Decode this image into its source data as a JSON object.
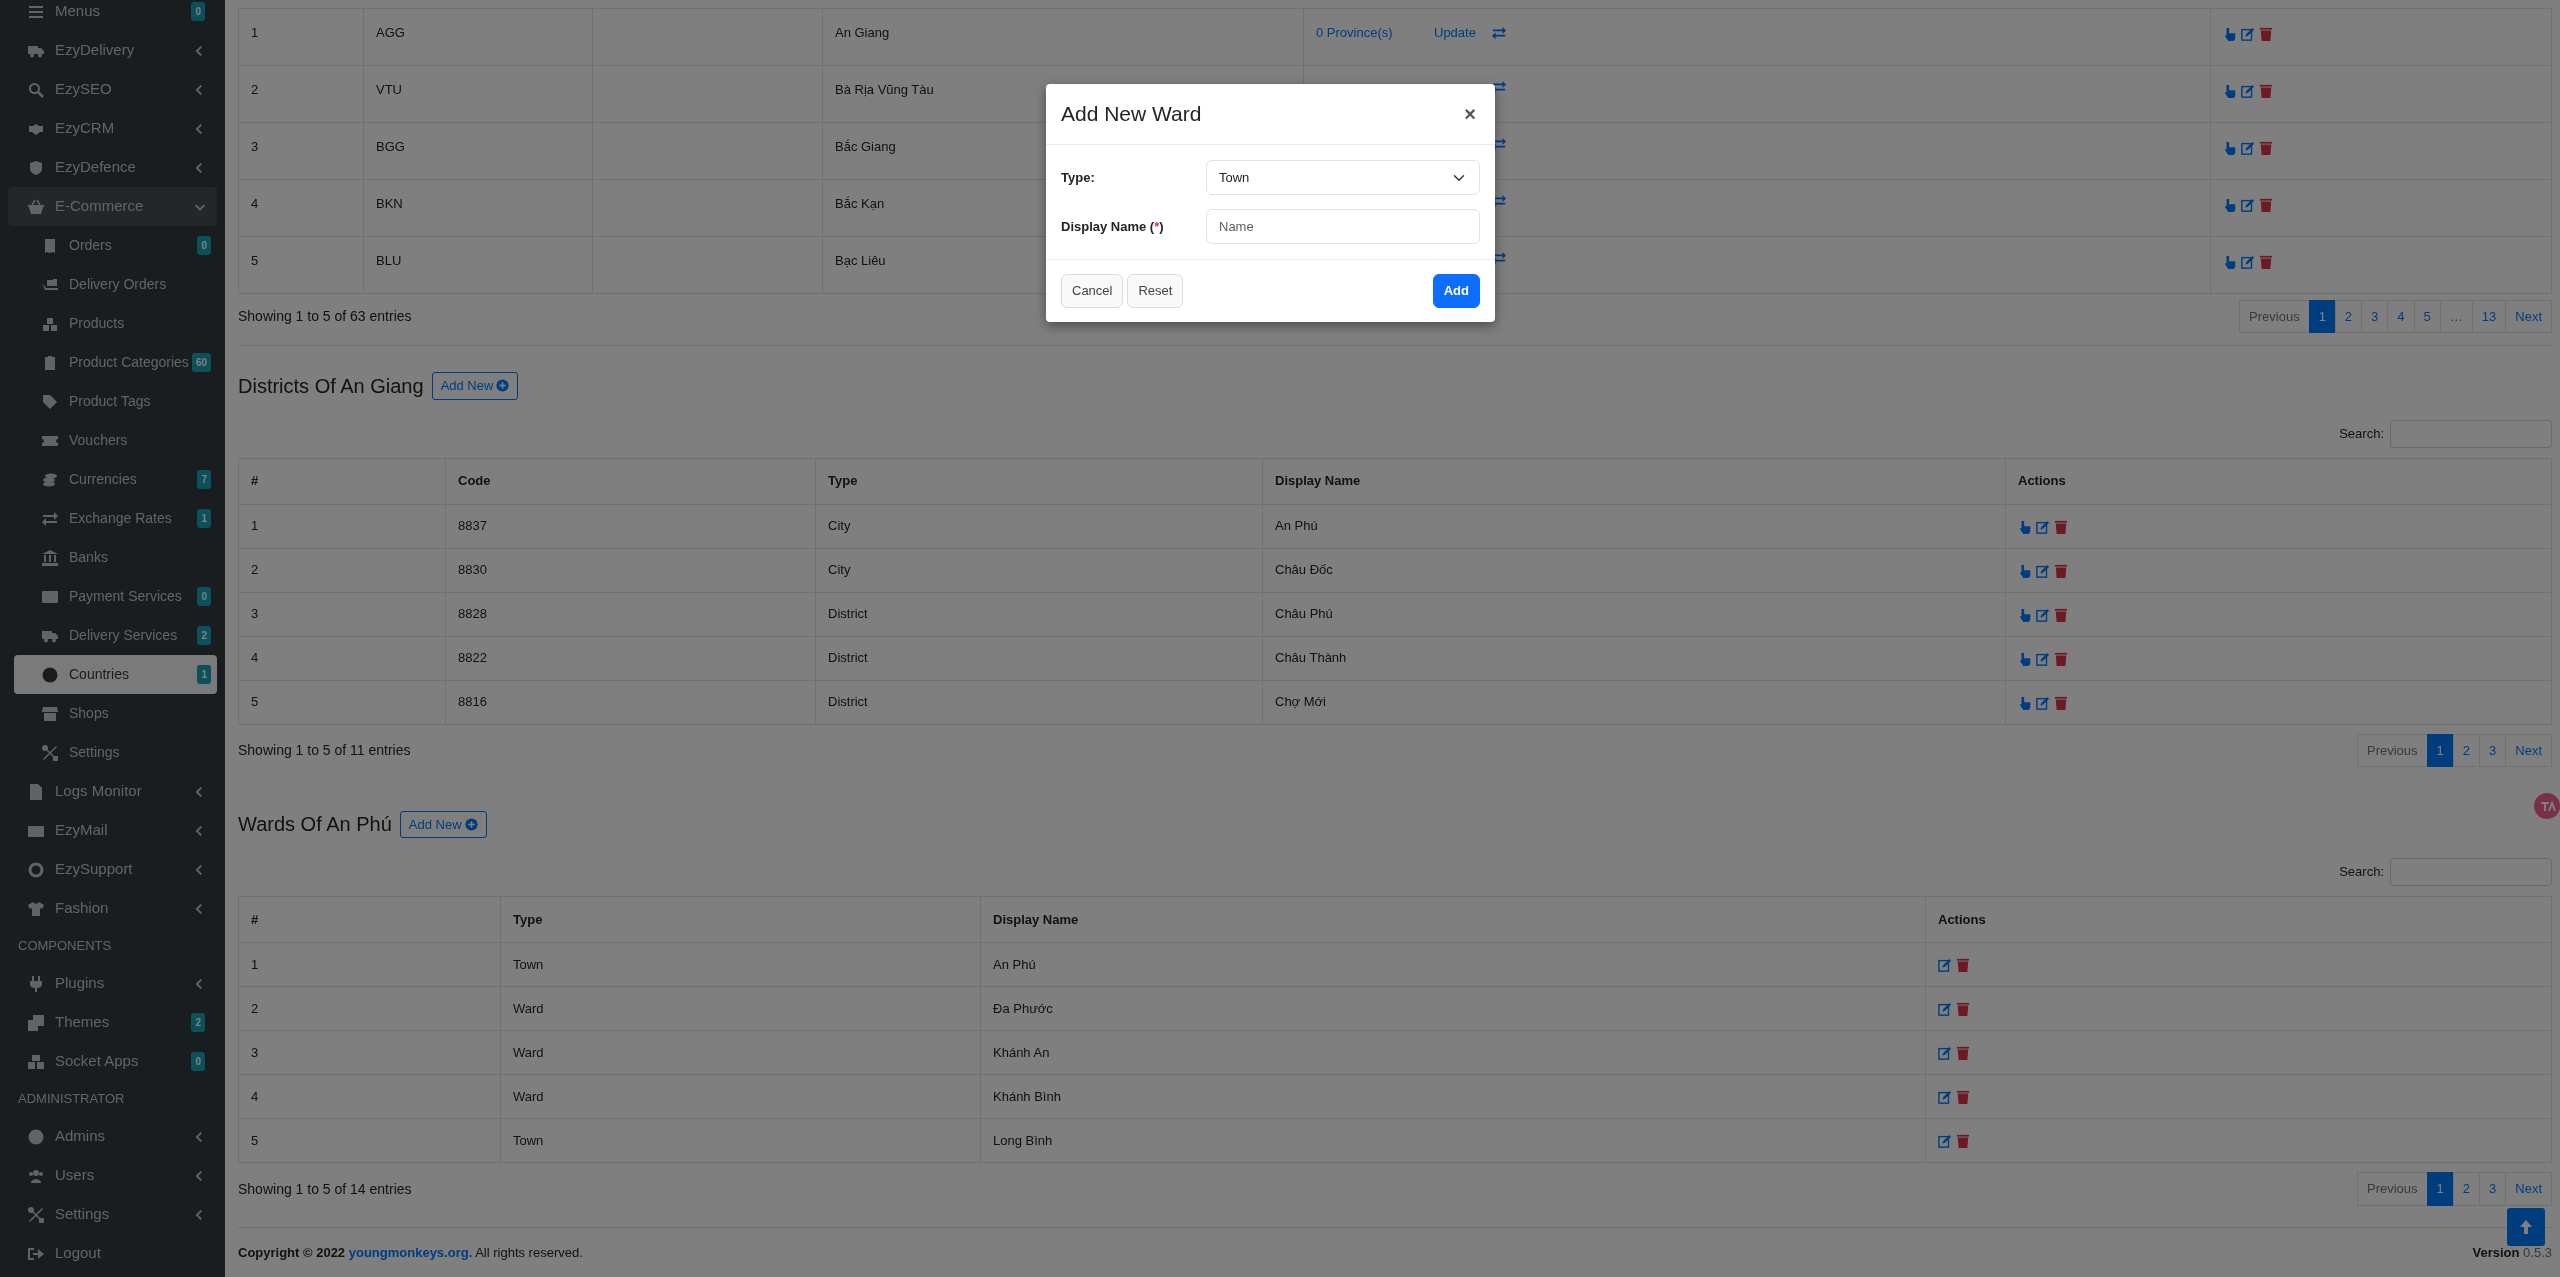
{
  "sidebar": {
    "items": [
      {
        "kind": "link",
        "label": "Menus",
        "badge": "0",
        "selected": false
      },
      {
        "kind": "link",
        "label": "EzyDelivery",
        "expanded": false,
        "selected": false
      },
      {
        "kind": "link",
        "label": "EzySEO",
        "expanded": false,
        "selected": false
      },
      {
        "kind": "link",
        "label": "EzyCRM",
        "expanded": false,
        "selected": false
      },
      {
        "kind": "link",
        "label": "EzyDefence",
        "expanded": false,
        "selected": false
      },
      {
        "kind": "link",
        "label": "E-Commerce",
        "expanded": true,
        "selected": false,
        "children": [
          {
            "label": "Orders",
            "badge": "0",
            "selected": false
          },
          {
            "label": "Delivery Orders",
            "selected": false
          },
          {
            "label": "Products",
            "selected": false
          },
          {
            "label": "Product Categories",
            "badge": "60",
            "selected": false
          },
          {
            "label": "Product Tags",
            "selected": false
          },
          {
            "label": "Vouchers",
            "selected": false
          },
          {
            "label": "Currencies",
            "badge": "7",
            "selected": false
          },
          {
            "label": "Exchange Rates",
            "badge": "1",
            "selected": false
          },
          {
            "label": "Banks",
            "selected": false
          },
          {
            "label": "Payment Services",
            "badge": "0",
            "selected": false
          },
          {
            "label": "Delivery Services",
            "badge": "2",
            "selected": false
          },
          {
            "label": "Countries",
            "badge": "1",
            "selected": true
          },
          {
            "label": "Shops",
            "selected": false
          },
          {
            "label": "Settings",
            "selected": false
          }
        ]
      },
      {
        "kind": "link",
        "label": "Logs Monitor",
        "expanded": false,
        "selected": false
      },
      {
        "kind": "link",
        "label": "EzyMail",
        "expanded": false,
        "selected": false
      },
      {
        "kind": "link",
        "label": "EzySupport",
        "expanded": false,
        "selected": false
      },
      {
        "kind": "link",
        "label": "Fashion",
        "expanded": false,
        "selected": false
      },
      {
        "kind": "header",
        "label": "COMPONENTS"
      },
      {
        "kind": "link",
        "label": "Plugins",
        "expanded": false,
        "selected": false
      },
      {
        "kind": "link",
        "label": "Themes",
        "badge": "2",
        "selected": false
      },
      {
        "kind": "link",
        "label": "Socket Apps",
        "badge": "0",
        "selected": false
      },
      {
        "kind": "header",
        "label": "ADMINISTRATOR"
      },
      {
        "kind": "link",
        "label": "Admins",
        "expanded": false,
        "selected": false
      },
      {
        "kind": "link",
        "label": "Users",
        "expanded": false,
        "selected": false
      },
      {
        "kind": "link",
        "label": "Settings",
        "expanded": false,
        "selected": false
      },
      {
        "kind": "link",
        "label": "Logout",
        "selected": false
      }
    ]
  },
  "provinces_table": {
    "rows": [
      {
        "cells": [
          "1",
          "AGG",
          "",
          "An Giang"
        ],
        "provinces_link": "0 Province(s)",
        "update_link": "Update"
      },
      {
        "cells": [
          "2",
          "VTU",
          "",
          "Bà Rịa Vũng Tàu"
        ]
      },
      {
        "cells": [
          "3",
          "BGG",
          "",
          "Bắc Giang"
        ]
      },
      {
        "cells": [
          "4",
          "BKN",
          "",
          "Bắc Kạn"
        ]
      },
      {
        "cells": [
          "5",
          "BLU",
          "",
          "Bạc Liêu"
        ]
      }
    ],
    "info": "Showing 1 to 5 of 63 entries",
    "pagination": [
      {
        "label": "Previous",
        "selected": false,
        "disabled": true
      },
      {
        "label": "1",
        "selected": true,
        "disabled": false
      },
      {
        "label": "2",
        "selected": false,
        "disabled": false
      },
      {
        "label": "3",
        "selected": false,
        "disabled": false
      },
      {
        "label": "4",
        "selected": false,
        "disabled": false
      },
      {
        "label": "5",
        "selected": false,
        "disabled": false
      },
      {
        "label": "…",
        "selected": false,
        "disabled": true
      },
      {
        "label": "13",
        "selected": false,
        "disabled": false
      },
      {
        "label": "Next",
        "selected": false,
        "disabled": false
      }
    ]
  },
  "sections": [
    {
      "title": "Districts Of An Giang",
      "add_button": "Add New",
      "search_label": "Search:",
      "columns": [
        "#",
        "Code",
        "Type",
        "Display Name",
        "Actions"
      ],
      "select_action": true,
      "rows": [
        [
          "1",
          "8837",
          "City",
          "An Phú"
        ],
        [
          "2",
          "8830",
          "City",
          "Châu Đốc"
        ],
        [
          "3",
          "8828",
          "District",
          "Châu Phú"
        ],
        [
          "4",
          "8822",
          "District",
          "Châu Thành"
        ],
        [
          "5",
          "8816",
          "District",
          "Chợ Mới"
        ]
      ],
      "info": "Showing 1 to 5 of 11 entries",
      "pagination": [
        {
          "label": "Previous",
          "selected": false,
          "disabled": true
        },
        {
          "label": "1",
          "selected": true,
          "disabled": false
        },
        {
          "label": "2",
          "selected": false,
          "disabled": false
        },
        {
          "label": "3",
          "selected": false,
          "disabled": false
        },
        {
          "label": "Next",
          "selected": false,
          "disabled": false
        }
      ]
    },
    {
      "title": "Wards Of An Phú",
      "add_button": "Add New",
      "search_label": "Search:",
      "columns": [
        "#",
        "Type",
        "Display Name",
        "Actions"
      ],
      "select_action": false,
      "rows": [
        [
          "1",
          "Town",
          "An Phú"
        ],
        [
          "2",
          "Ward",
          "Đa Phước"
        ],
        [
          "3",
          "Ward",
          "Khánh An"
        ],
        [
          "4",
          "Ward",
          "Khánh Bình"
        ],
        [
          "5",
          "Town",
          "Long Bình"
        ]
      ],
      "info": "Showing 1 to 5 of 14 entries",
      "pagination": [
        {
          "label": "Previous",
          "selected": false,
          "disabled": true
        },
        {
          "label": "1",
          "selected": true,
          "disabled": false
        },
        {
          "label": "2",
          "selected": false,
          "disabled": false
        },
        {
          "label": "3",
          "selected": false,
          "disabled": false
        },
        {
          "label": "Next",
          "selected": false,
          "disabled": false
        }
      ]
    }
  ],
  "footer": {
    "copyright": "Copyright © 2022",
    "link": "youngmonkeys.org.",
    "suffix": "All rights reserved.",
    "version_label": "Version",
    "version": "0.5.3"
  },
  "modal": {
    "title": "Add New Ward",
    "close": "×",
    "fields": [
      {
        "kind": "select",
        "label": "Type:",
        "value": "Town"
      },
      {
        "kind": "text",
        "label": "Display Name ",
        "required_mark": "(*)",
        "placeholder": "Name"
      }
    ],
    "buttons": [
      {
        "label": "Cancel",
        "kind": "secondary"
      },
      {
        "label": "Reset",
        "kind": "secondary"
      },
      {
        "label": "Add",
        "kind": "primary"
      }
    ]
  }
}
